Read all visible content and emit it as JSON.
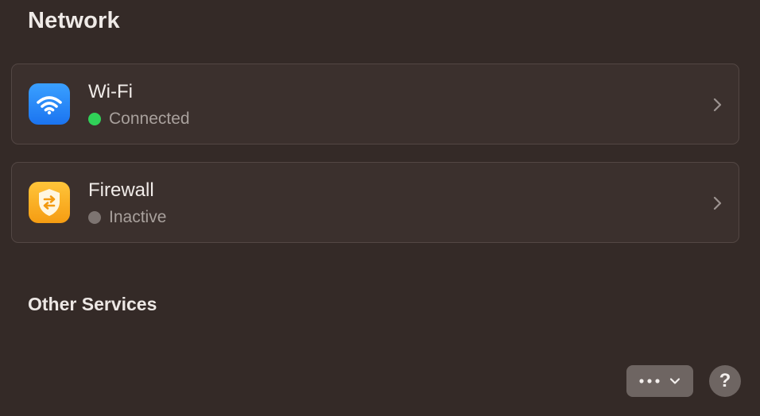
{
  "page": {
    "title": "Network"
  },
  "services": [
    {
      "name": "Wi-Fi",
      "status": "Connected",
      "status_color": "#30d158",
      "icon": "wifi-icon",
      "icon_color": "#1f7cf2"
    },
    {
      "name": "Firewall",
      "status": "Inactive",
      "status_color": "#7d7471",
      "icon": "firewall-shield-icon",
      "icon_color": "#f8a91a"
    }
  ],
  "other_services": {
    "title": "Other Services"
  },
  "toolbar": {
    "more_icon": "ellipsis-icon",
    "dropdown_icon": "chevron-down-icon",
    "help_label": "?"
  },
  "colors": {
    "background": "#342a27",
    "row_background": "#3b302d",
    "row_border": "#534744",
    "button_background": "#6e6562"
  }
}
